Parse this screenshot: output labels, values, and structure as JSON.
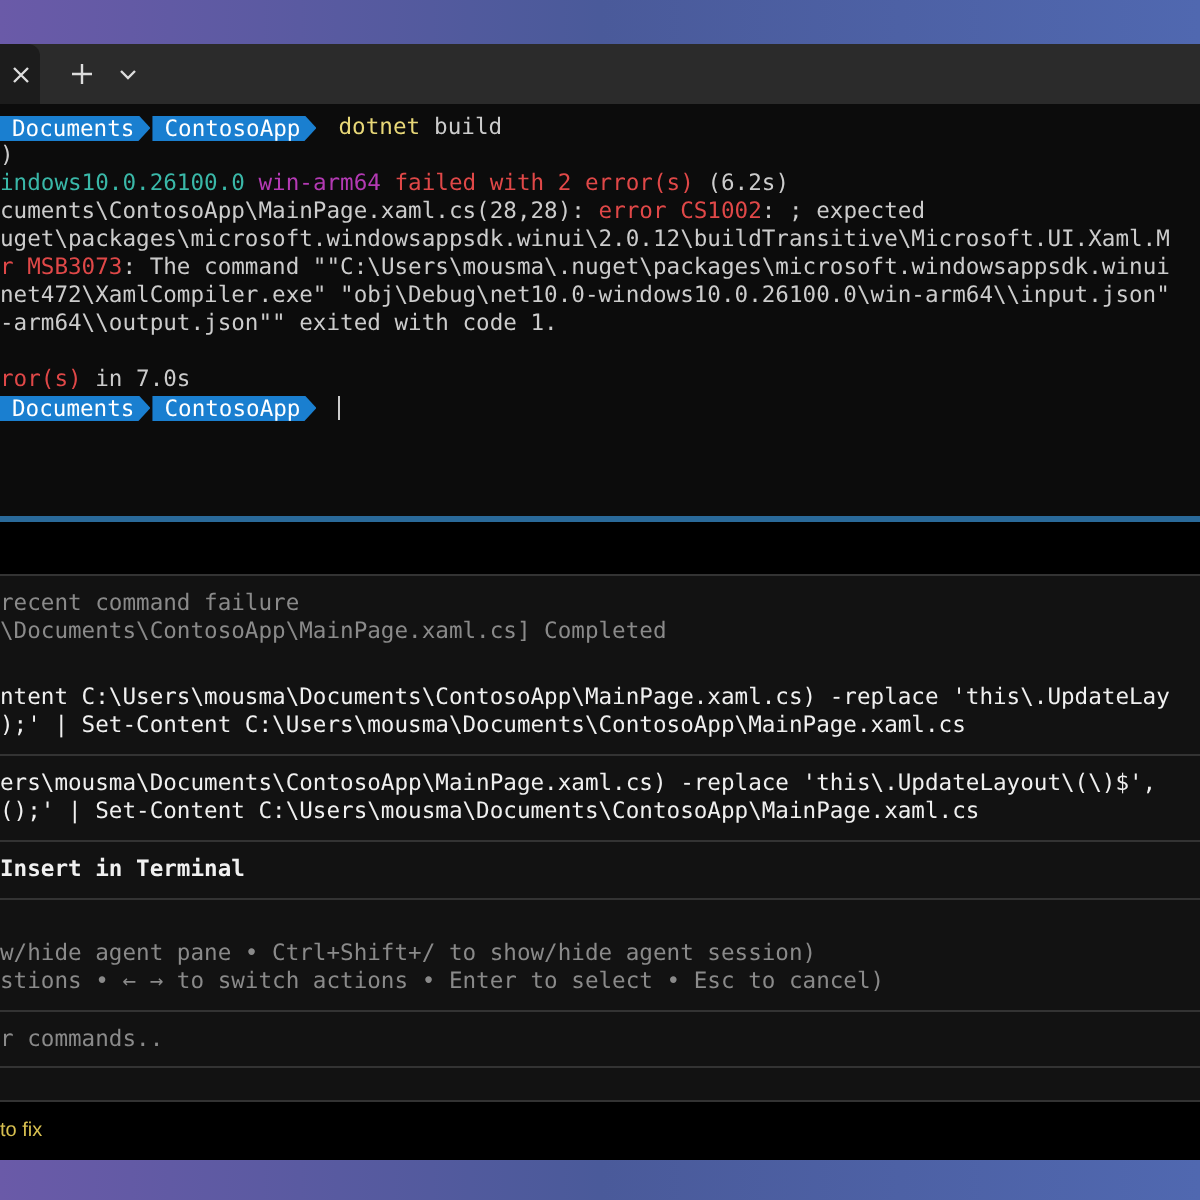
{
  "terminal": {
    "lines": [
      {
        "kind": "prompt",
        "segments": [
          "Documents",
          "ContosoApp"
        ],
        "command": "dotnet",
        "args": "build"
      },
      {
        "kind": "text",
        "parts": [
          {
            "text": ")",
            "color": "#cccccc"
          }
        ]
      },
      {
        "kind": "text",
        "parts": [
          {
            "text": "indows10.0.26100.0 ",
            "color": "#3ab8a8"
          },
          {
            "text": "win-arm64 ",
            "color": "#b43ab4"
          },
          {
            "text": "failed with 2 error(s) ",
            "color": "#e04848"
          },
          {
            "text": "(6.2s)",
            "color": "#cccccc"
          }
        ]
      },
      {
        "kind": "text",
        "parts": [
          {
            "text": "cuments\\ContosoApp\\MainPage.xaml.cs(28,28): ",
            "color": "#cccccc"
          },
          {
            "text": "error CS1002",
            "color": "#e04848"
          },
          {
            "text": ": ; expected",
            "color": "#cccccc"
          }
        ]
      },
      {
        "kind": "text",
        "parts": [
          {
            "text": "uget\\packages\\microsoft.windowsappsdk.winui\\2.0.12\\buildTransitive\\Microsoft.UI.Xaml.M",
            "color": "#cccccc"
          }
        ]
      },
      {
        "kind": "text",
        "parts": [
          {
            "text": "r MSB3073",
            "color": "#e04848"
          },
          {
            "text": ": The command \"\"C:\\Users\\mousma\\.nuget\\packages\\microsoft.windowsappsdk.winui",
            "color": "#cccccc"
          }
        ]
      },
      {
        "kind": "text",
        "parts": [
          {
            "text": "net472\\XamlCompiler.exe\" \"obj\\Debug\\net10.0-windows10.0.26100.0\\win-arm64\\\\input.json\"",
            "color": "#cccccc"
          }
        ]
      },
      {
        "kind": "text",
        "parts": [
          {
            "text": "-arm64\\\\output.json\"\" exited with code 1.",
            "color": "#cccccc"
          }
        ]
      },
      {
        "kind": "blank"
      },
      {
        "kind": "text",
        "parts": [
          {
            "text": "ror(s)",
            "color": "#e04848"
          },
          {
            "text": " in 7.0s",
            "color": "#cccccc"
          }
        ]
      },
      {
        "kind": "prompt",
        "segments": [
          "Documents",
          "ContosoApp"
        ],
        "cursor": true
      }
    ]
  },
  "agent_pane": {
    "blocks": [
      {
        "kind": "status",
        "lines": [
          "recent command failure",
          "\\Documents\\ContosoApp\\MainPage.xaml.cs] Completed"
        ]
      },
      {
        "kind": "command",
        "lines": [
          "ntent C:\\Users\\mousma\\Documents\\ContosoApp\\MainPage.xaml.cs) -replace 'this\\.UpdateLay",
          ");' | Set-Content C:\\Users\\mousma\\Documents\\ContosoApp\\MainPage.xaml.cs"
        ]
      },
      {
        "kind": "command",
        "lines": [
          "ers\\mousma\\Documents\\ContosoApp\\MainPage.xaml.cs) -replace 'this\\.UpdateLayout\\(\\)$',",
          "();' | Set-Content C:\\Users\\mousma\\Documents\\ContosoApp\\MainPage.xaml.cs"
        ]
      },
      {
        "kind": "action",
        "lines": [
          "Insert in Terminal"
        ]
      },
      {
        "kind": "help",
        "lines": [
          "w/hide agent pane • Ctrl+Shift+/ to show/hide agent session)",
          "stions • ← → to switch actions • Enter to select • Esc to cancel)"
        ]
      }
    ],
    "input": {
      "placeholder": "r commands.."
    }
  },
  "status_bar": {
    "text": "to fix"
  }
}
